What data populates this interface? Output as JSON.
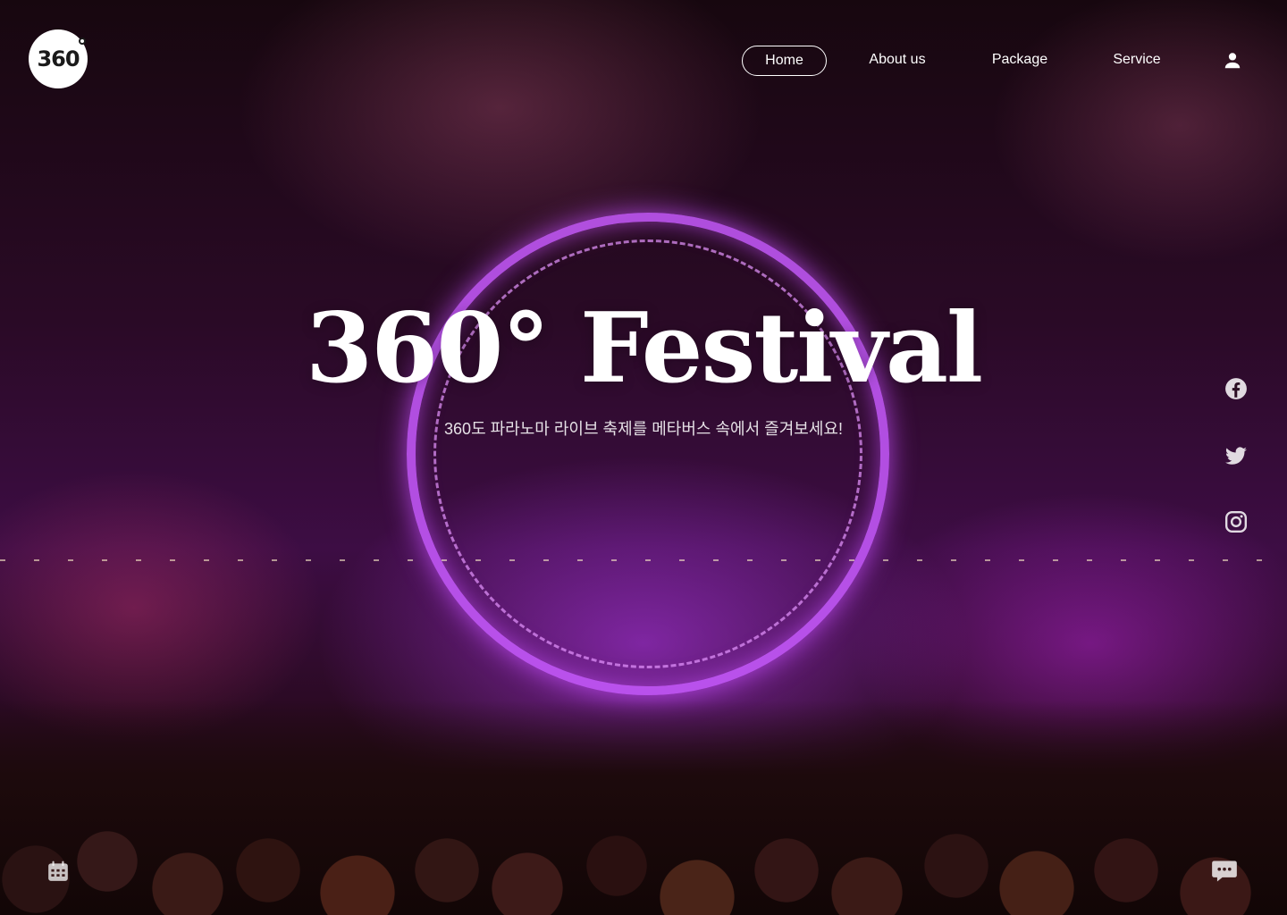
{
  "brand": {
    "logo_text": "360"
  },
  "nav": {
    "items": [
      {
        "label": "Home",
        "active": true
      },
      {
        "label": "About us",
        "active": false
      },
      {
        "label": "Package",
        "active": false
      },
      {
        "label": "Service",
        "active": false
      }
    ],
    "user_icon": "user-icon"
  },
  "hero": {
    "title": "360° Festival",
    "subtitle": "360도 파라노마 라이브 축제를 메타버스 속에서 즐겨보세요!"
  },
  "social": [
    "facebook-icon",
    "twitter-icon",
    "instagram-icon"
  ],
  "corner_icons": {
    "left": "calendar-icon",
    "right": "chat-icon"
  },
  "colors": {
    "text": "#ffffff",
    "accent_glow": "#c85aff"
  }
}
